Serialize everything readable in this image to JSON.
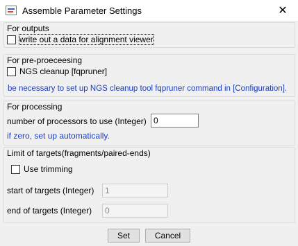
{
  "window": {
    "title": "Assemble Parameter Settings",
    "close_glyph": "✕"
  },
  "outputs": {
    "label": "For outputs",
    "write_alignment_label": "write out a data for alignment viewer"
  },
  "preprocessing": {
    "label": "For pre-proeceesing",
    "ngs_cleanup_label": "NGS cleanup [fqpruner]",
    "ngs_note": "be necessary to set up NGS cleanup tool fqpruner command in [Configuration]."
  },
  "processing": {
    "label": "For processing",
    "processors_label": "number of processors to use (Integer)",
    "processors_value": "0",
    "processors_note": "if zero, set up automatically."
  },
  "targets": {
    "label": "Limit of targets(fragments/paired-ends)",
    "use_trimming_label": "Use trimming",
    "start_label": "start of targets (Integer)",
    "start_value": "1",
    "end_label": "end of targets (Integer)",
    "end_value": "0"
  },
  "buttons": {
    "set": "Set",
    "cancel": "Cancel"
  }
}
